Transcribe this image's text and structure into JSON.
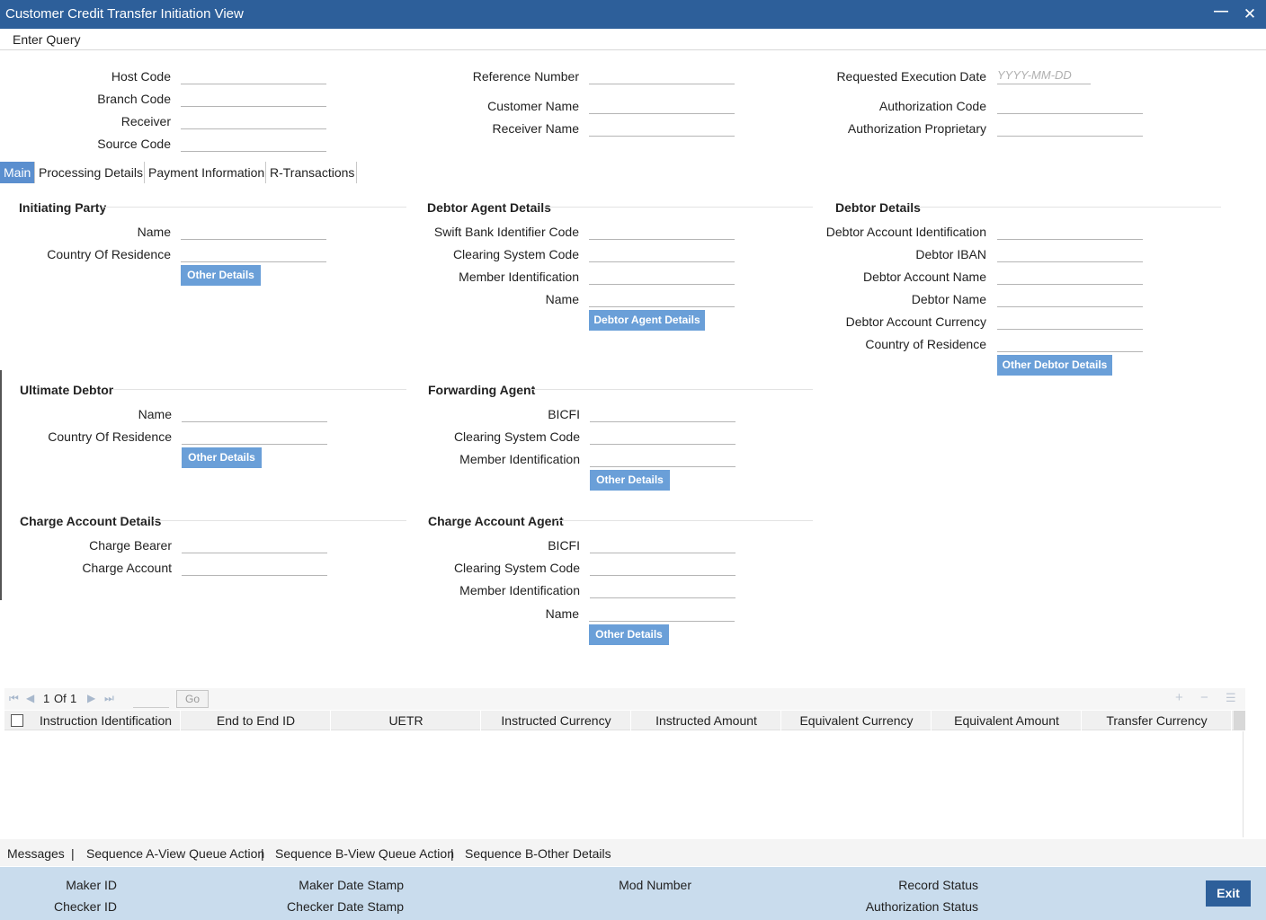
{
  "window": {
    "title": "Customer Credit Transfer Initiation View",
    "minimize_icon": "minimize-icon",
    "close_icon": "close-icon"
  },
  "toolbar": {
    "enter_query": "Enter Query"
  },
  "header": {
    "host_code": "Host Code",
    "branch_code": "Branch Code",
    "receiver": "Receiver",
    "source_code": "Source Code",
    "reference_number": "Reference Number",
    "customer_name": "Customer Name",
    "receiver_name": "Receiver Name",
    "requested_execution_date": "Requested Execution Date",
    "date_placeholder": "YYYY-MM-DD",
    "authorization_code": "Authorization Code",
    "authorization_proprietary": "Authorization Proprietary"
  },
  "tabs": [
    "Main",
    "Processing Details",
    "Payment Information",
    "R-Transactions"
  ],
  "initiating_party": {
    "title": "Initiating Party",
    "name": "Name",
    "country": "Country Of Residence",
    "button": "Other Details"
  },
  "debtor_agent": {
    "title": "Debtor Agent Details",
    "swift": "Swift Bank Identifier Code",
    "clearing": "Clearing System Code",
    "member": "Member Identification",
    "name": "Name",
    "button": "Debtor Agent Details"
  },
  "debtor": {
    "title": "Debtor Details",
    "account_id": "Debtor Account Identification",
    "iban": "Debtor IBAN",
    "account_name": "Debtor Account Name",
    "name": "Debtor Name",
    "currency": "Debtor Account Currency",
    "country": "Country of Residence",
    "button": "Other Debtor Details"
  },
  "ultimate_debtor": {
    "title": "Ultimate Debtor",
    "name": "Name",
    "country": "Country Of Residence",
    "button": "Other Details"
  },
  "forwarding_agent": {
    "title": "Forwarding Agent",
    "bicfi": "BICFI",
    "clearing": "Clearing System Code",
    "member": "Member Identification",
    "button": "Other Details"
  },
  "charge_account": {
    "title": "Charge Account Details",
    "bearer": "Charge Bearer",
    "account": "Charge Account"
  },
  "charge_agent": {
    "title": "Charge Account Agent",
    "bicfi": "BICFI",
    "clearing": "Clearing System Code",
    "member": "Member Identification",
    "name": "Name",
    "button": "Other Details"
  },
  "grid": {
    "page_current": "1",
    "page_of": "Of",
    "page_total": "1",
    "go": "Go",
    "columns": [
      "Instruction Identification",
      "End to End ID",
      "UETR",
      "Instructed Currency",
      "Instructed Amount",
      "Equivalent Currency",
      "Equivalent Amount",
      "Transfer Currency"
    ]
  },
  "links": [
    "Messages",
    "Sequence A-View Queue Action",
    "Sequence B-View Queue Action",
    "Sequence B-Other Details"
  ],
  "link_separator": "|",
  "footer": {
    "maker_id": "Maker ID",
    "checker_id": "Checker ID",
    "maker_date": "Maker Date Stamp",
    "checker_date": "Checker Date Stamp",
    "mod_number": "Mod Number",
    "record_status": "Record Status",
    "auth_status": "Authorization Status",
    "exit": "Exit"
  }
}
